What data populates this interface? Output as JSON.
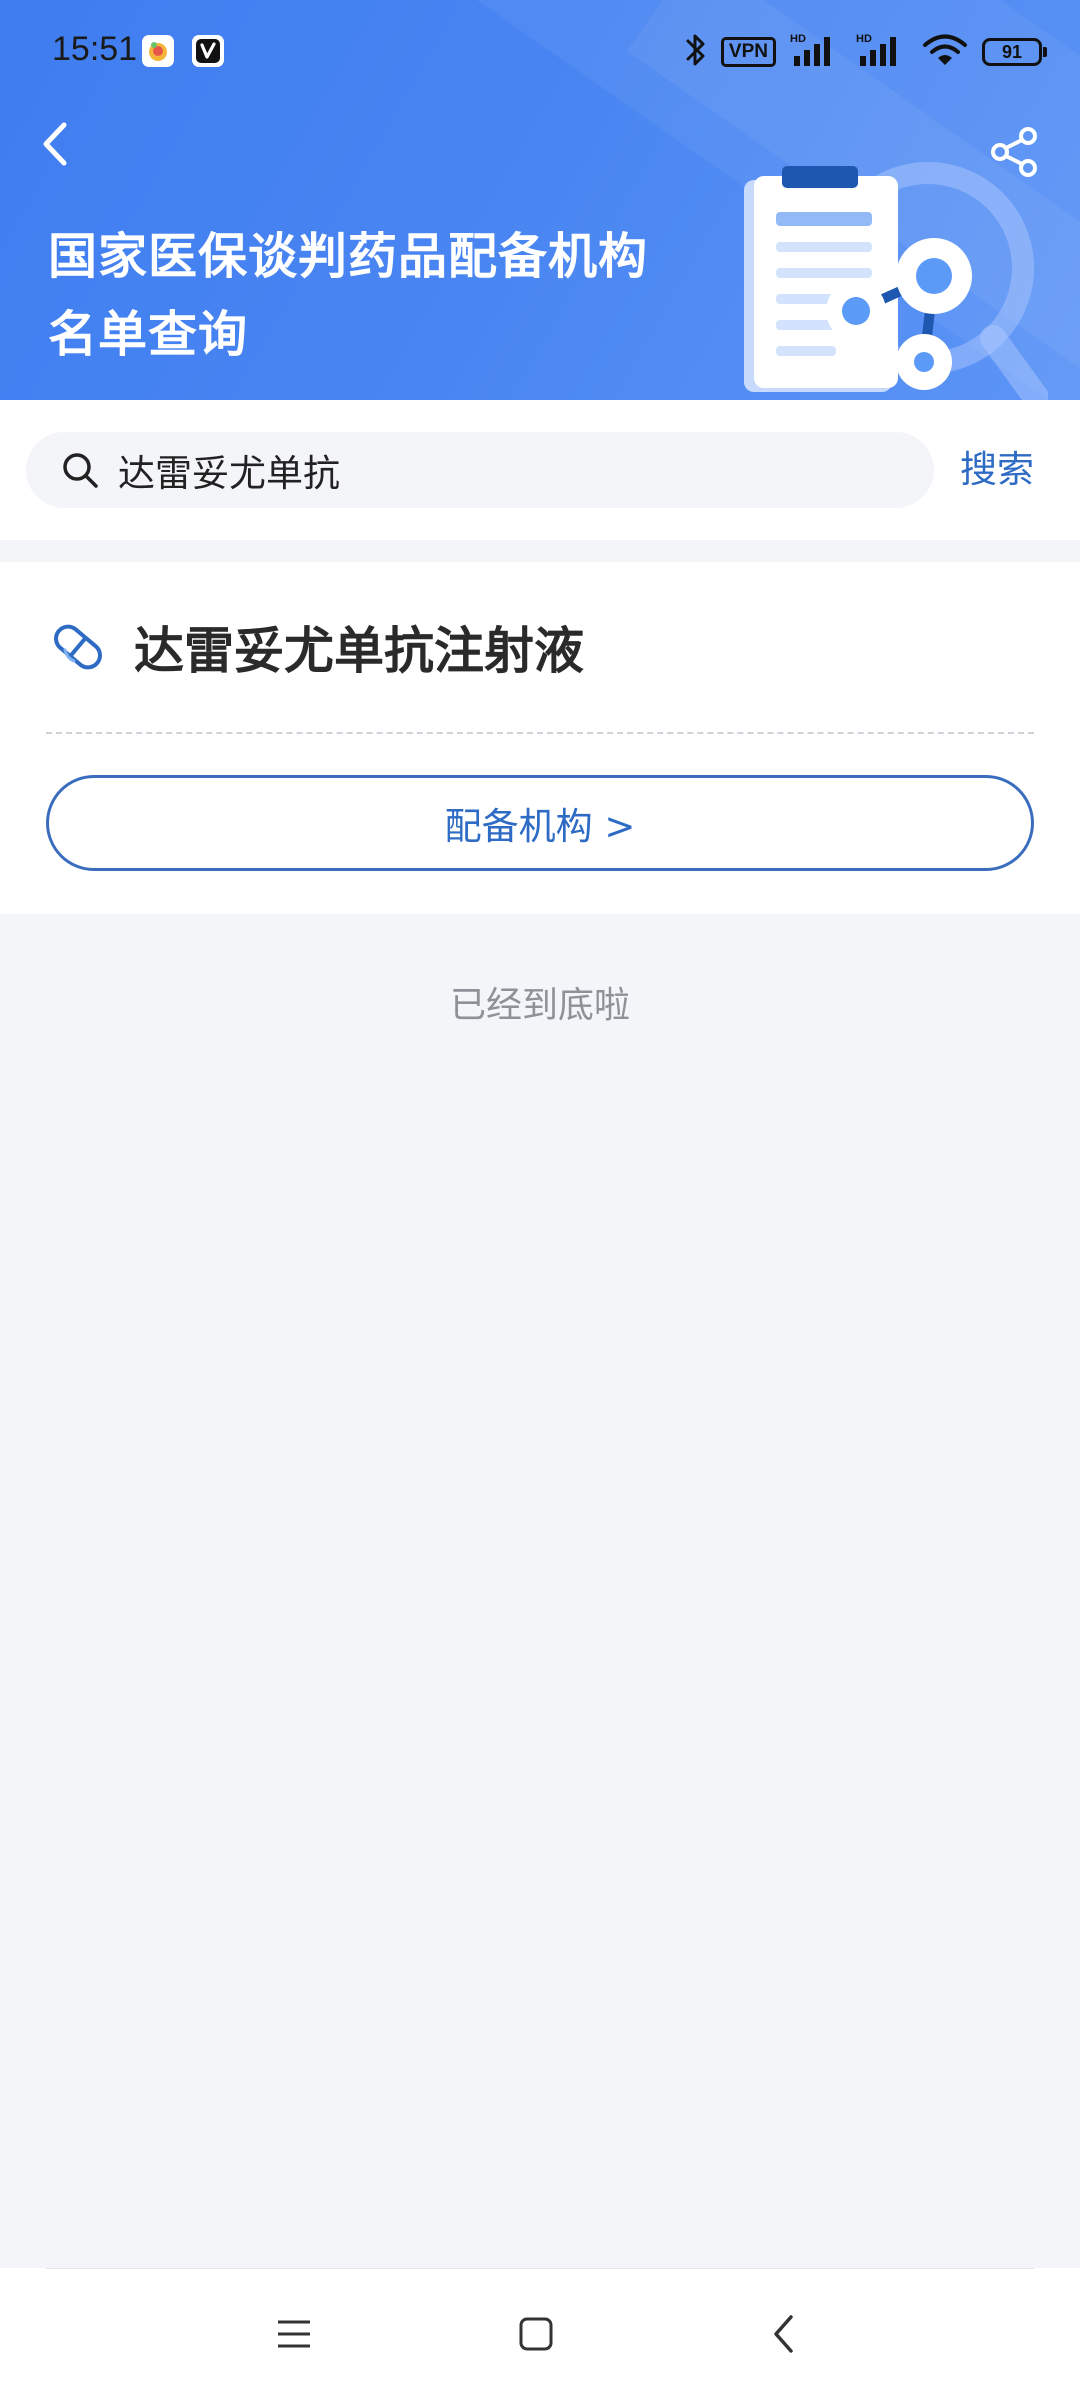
{
  "status_bar": {
    "time": "15:51",
    "vpn": "VPN",
    "battery": "91"
  },
  "header": {
    "title_line1": "国家医保谈判药品配备机构",
    "title_line2": "名单查询"
  },
  "search": {
    "query": "达雷妥尤单抗",
    "button_label": "搜索"
  },
  "result": {
    "drug_name": "达雷妥尤单抗注射液",
    "institution_button_label": "配备机构 >"
  },
  "footer_text": "已经到底啦",
  "colors": {
    "header_blue": "#4a86f2",
    "link_blue": "#2d6bc4",
    "page_bg": "#f4f5f9"
  }
}
